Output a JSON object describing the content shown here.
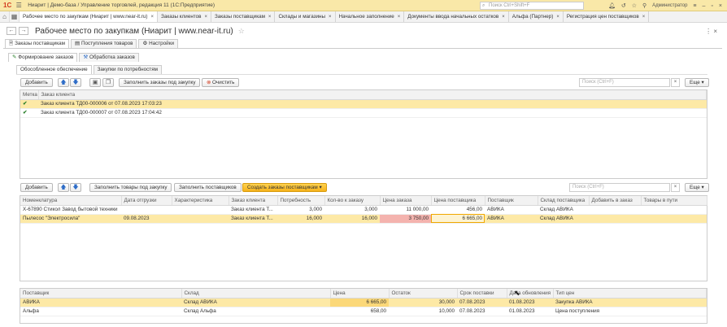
{
  "titlebar": {
    "logo": "1С",
    "title": "Ниарит | Демо-база / Управление торговлей, редакция 11  (1С:Предприятие)",
    "search_placeholder": "Поиск Ctrl+Shift+F",
    "user": "Администратор"
  },
  "open_tabs": [
    "Рабочее место по закупкам (Ниарит | www.near-it.ru)",
    "Заказы клиентов",
    "Заказы поставщикам",
    "Склады и магазины",
    "Начальное заполнение",
    "Документы ввода начальных остатков",
    "Альфа (Партнер)",
    "Регистрация цен поставщиков"
  ],
  "page": {
    "title": "Рабочее место по закупкам (Ниарит | www.near-it.ru)"
  },
  "form_tabs": [
    "Заказы поставщикам",
    "Поступления товаров",
    "Настройки"
  ],
  "section_tabs": [
    "Формирование заказов",
    "Обработка заказов"
  ],
  "sub_tabs": [
    "Обособленное обеспечение",
    "Закупки по потребностям"
  ],
  "toolbar1": {
    "add": "Добавить",
    "fill_orders": "Заполнить заказы под закупку",
    "clear": "Очистить",
    "search_placeholder": "Поиск (Ctrl+F)",
    "more": "Еще"
  },
  "orders_table": {
    "headers": [
      "Метка",
      "Заказ клиента"
    ],
    "rows": [
      {
        "checked": true,
        "order": "Заказ клиента ТД00-000006 от 07.08.2023 17:03:23"
      },
      {
        "checked": true,
        "order": "Заказ клиента ТД00-000007 от 07.08.2023 17:04:42"
      }
    ]
  },
  "toolbar2": {
    "add": "Добавить",
    "fill_goods": "Заполнить товары под закупку",
    "fill_suppliers": "Заполнить поставщиков",
    "create_orders": "Создать заказы поставщикам",
    "search_placeholder": "Поиск (Ctrl+F)",
    "more": "Еще"
  },
  "goods_table": {
    "headers": [
      "Номенклатура",
      "Дата отгрузки",
      "Характеристика",
      "Заказ клиента",
      "Потребность",
      "Кол-во к заказу",
      "Цена заказа",
      "Цена поставщика",
      "Поставщик",
      "Склад поставщика",
      "Добавить в заказ",
      "Товары в пути"
    ],
    "rows": [
      [
        "X-67890 Стикол Завод бытовой техники",
        "",
        "",
        "Заказ клиента Т...",
        "3,000",
        "3,000",
        "11 000,00",
        "456,00",
        "АВИКА",
        "Склад АВИКА",
        "",
        ""
      ],
      [
        "Пылесос \"Электросила\"",
        "09.08.2023",
        "",
        "Заказ клиента Т...",
        "16,000",
        "16,000",
        "3 750,00",
        "6 665,00",
        "АВИКА",
        "Склад АВИКА",
        "",
        ""
      ]
    ]
  },
  "suppliers_table": {
    "headers": [
      "Поставщик",
      "Склад",
      "Цена",
      "Остаток",
      "Срок поставки",
      "Дата обновления",
      "Тип цен"
    ],
    "rows": [
      [
        "АВИКА",
        "Склад АВИКА",
        "6 665,00",
        "30,000",
        "07.08.2023",
        "01.08.2023",
        "Закупка АВИКА"
      ],
      [
        "Альфа",
        "Склад Альфа",
        "658,00",
        "10,000",
        "07.08.2023",
        "01.08.2023",
        "Цена поступления"
      ]
    ]
  }
}
